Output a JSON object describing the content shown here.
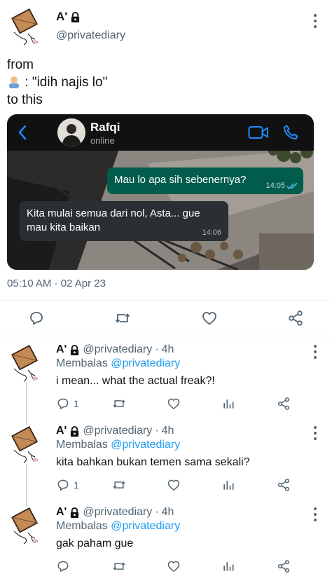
{
  "tweet": {
    "author_name": "A'",
    "handle": "@privatediary",
    "text_line1": "from",
    "text_line2": " : \"idih najis lo\"",
    "text_line3": "to this",
    "timestamp": "05:10 AM · 02 Apr 23",
    "icons": {
      "author_lock": "lock-icon",
      "more": "more-icon",
      "person_emoji": "person-emoji-icon",
      "reply": "reply-icon",
      "retweet": "retweet-icon",
      "like": "heart-icon",
      "share": "share-icon"
    }
  },
  "chat": {
    "contact_name": "Rafqi",
    "contact_status": "online",
    "outgoing_message": "Mau lo apa sih sebenernya?",
    "outgoing_time": "14:05",
    "incoming_message": "Kita mulai semua dari nol, Asta... gue mau kita baikan",
    "incoming_time": "14:06",
    "accent_color": "#1f8bff",
    "outgoing_bubble_color": "#025c4c",
    "incoming_bubble_color": "#2a2f33"
  },
  "replies": [
    {
      "author_name": "A'",
      "handle": "@privatediary",
      "separator": "·",
      "time": "4h",
      "replying_prefix": "Membalas ",
      "replying_to": "@privatediary",
      "text": "i mean... what the actual freak?!",
      "reply_count": "1"
    },
    {
      "author_name": "A'",
      "handle": "@privatediary",
      "separator": "·",
      "time": "4h",
      "replying_prefix": "Membalas ",
      "replying_to": "@privatediary",
      "text": "kita bahkan bukan temen sama sekali?",
      "reply_count": "1"
    },
    {
      "author_name": "A'",
      "handle": "@privatediary",
      "separator": "·",
      "time": "4h",
      "replying_prefix": "Membalas ",
      "replying_to": "@privatediary",
      "text": "gak paham gue",
      "reply_count": ""
    }
  ],
  "colors": {
    "link": "#1d9bf0",
    "secondary_text": "#536471"
  }
}
